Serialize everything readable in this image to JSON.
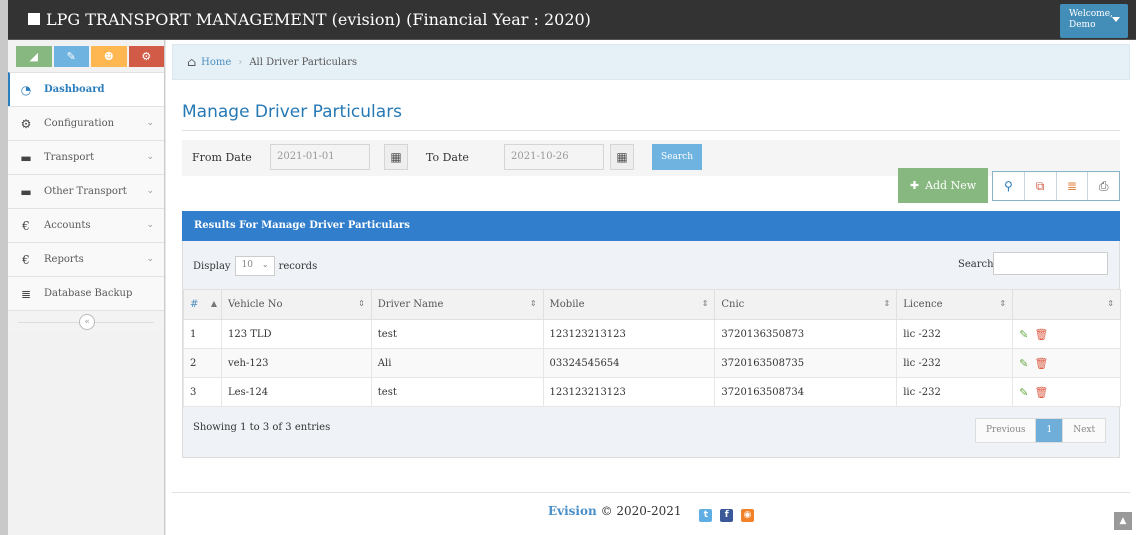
{
  "header": {
    "title": "LPG TRANSPORT MANAGEMENT (evision) (Financial Year : 2020)",
    "welcome": "Welcome,",
    "user": "Demo"
  },
  "sidebar": {
    "shortcuts": [
      "chart-icon",
      "pencil-icon",
      "users-icon",
      "cogs-icon"
    ],
    "items": [
      {
        "label": "Dashboard",
        "icon": "tachometer-icon",
        "active": true
      },
      {
        "label": "Configuration",
        "icon": "cogs-icon"
      },
      {
        "label": "Transport",
        "icon": "truck-icon"
      },
      {
        "label": "Other Transport",
        "icon": "truck-icon"
      },
      {
        "label": "Accounts",
        "icon": "euro-icon"
      },
      {
        "label": "Reports",
        "icon": "euro-icon"
      },
      {
        "label": "Database Backup",
        "icon": "database-icon"
      }
    ]
  },
  "breadcrumb": {
    "home": "Home",
    "current": "All Driver Particulars"
  },
  "page": {
    "title": "Manage Driver Particulars"
  },
  "filters": {
    "from_label": "From Date",
    "from_value": "2021-01-01",
    "to_label": "To Date",
    "to_value": "2021-10-26",
    "search_label": "Search"
  },
  "toolbar": {
    "add_new": "Add New"
  },
  "results": {
    "title": "Results For Manage Driver Particulars",
    "display": "Display",
    "page_length": "10",
    "records": "records",
    "search_label": "Search:",
    "columns": [
      "#",
      "Vehicle No",
      "Driver Name",
      "Mobile",
      "Cnic",
      "Licence",
      ""
    ],
    "rows": [
      [
        "1",
        "123 TLD",
        "test",
        "123123213123",
        "3720136350873",
        "lic -232"
      ],
      [
        "2",
        "veh-123",
        "Ali",
        "03324545654",
        "3720163508735",
        "lic -232"
      ],
      [
        "3",
        "Les-124",
        "test",
        "123123213123",
        "3720163508734",
        "lic -232"
      ]
    ],
    "showing": "Showing 1 to 3 of 3 entries",
    "pager": {
      "previous": "Previous",
      "current": "1",
      "next": "Next"
    }
  },
  "footer": {
    "brand": "Evision",
    "copyright": "© 2020-2021"
  },
  "colors": {
    "topbar": "#333333",
    "accent": "#307ecc",
    "add": "#87b87f",
    "search": "#6fb3e0"
  }
}
